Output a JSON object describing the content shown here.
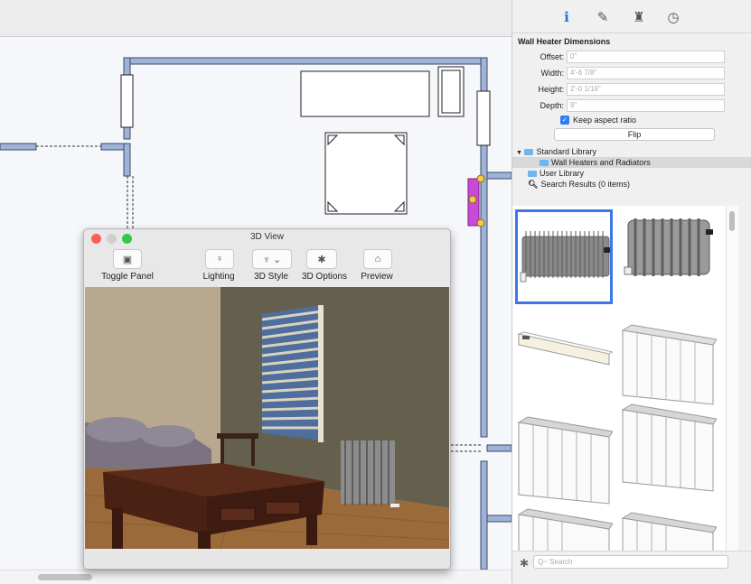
{
  "inspector": {
    "tabs": [
      "info-icon",
      "paint-brush-icon",
      "chair-icon",
      "clock-icon"
    ],
    "title": "Wall Heater Dimensions",
    "fields": [
      {
        "label": "Offset:",
        "value": "0\""
      },
      {
        "label": "Width:",
        "value": "4'-6 7/8\""
      },
      {
        "label": "Height:",
        "value": "2'-0 1/16\""
      },
      {
        "label": "Depth:",
        "value": "9\""
      }
    ],
    "keep_aspect": {
      "label": "Keep aspect ratio",
      "checked": true
    },
    "flip_label": "Flip"
  },
  "library": {
    "items": [
      {
        "label": "Standard Library"
      },
      {
        "label": "Wall Heaters and Radiators"
      },
      {
        "label": "User Library"
      },
      {
        "label": "Search Results (0 items)"
      }
    ]
  },
  "gallery": {
    "selected_index": 0,
    "items": [
      "radiator-classic",
      "radiator-column",
      "baseboard-heater",
      "panel-radiator",
      "panel-radiator-2",
      "panel-radiator-3",
      "panel-radiator-4",
      "panel-radiator-5"
    ]
  },
  "search": {
    "placeholder": "Q~ Search"
  },
  "view3d": {
    "title": "3D View",
    "toolbar": [
      {
        "label": "Toggle Panel",
        "icon": "toggle-panel-icon"
      },
      {
        "label": "Lighting",
        "icon": "bulb-icon"
      },
      {
        "label": "3D Style",
        "icon": "brush-icon"
      },
      {
        "label": "3D Options",
        "icon": "gear-icon"
      },
      {
        "label": "Preview",
        "icon": "home-icon"
      }
    ]
  },
  "colors": {
    "wall": "#9fb3d8",
    "wall_border": "#3d4a64",
    "accent": "#3b78e7",
    "heater_selection": "#c94ad6"
  }
}
